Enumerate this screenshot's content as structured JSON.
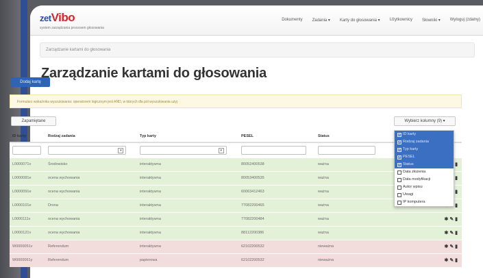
{
  "brand": {
    "zet": "zet",
    "logo": "Vibo",
    "subtitle": "system zarządzania procesem głosowania"
  },
  "nav": [
    "Dokumenty",
    "Zadania ▾",
    "Karty do głosowania ▾",
    "Użytkownicy",
    "Słowniki ▾",
    "Wyloguj (zdalny)"
  ],
  "breadcrumb": "Zarządzanie kartami do głosowania",
  "page_title": "Zarządzanie kartami do głosowania",
  "add_button": "Dodaj kartę",
  "alert": "Formularz wskaźnika wyszukiwania: operatorem logicznym jest AND, w których dla pól wyszukiwania użyj",
  "saved_button": "Zapamiętane",
  "columns_button": "Wybierz kolumny (9) ▾",
  "columns": [
    "ID karty",
    "Rodzaj zadania",
    "Typ karty",
    "PESEL",
    "Status",
    ""
  ],
  "rows": [
    {
      "id": "L0000071v",
      "task": "Środowisko",
      "type": "interaktywna",
      "pesel": "80052400538",
      "status": "ważna",
      "state": "ok"
    },
    {
      "id": "L0000081e",
      "task": "ocena wychowania",
      "type": "interaktywna",
      "pesel": "80053400535",
      "status": "ważna",
      "state": "ok"
    },
    {
      "id": "L0000091e",
      "task": "ocena wychowania",
      "type": "interaktywna",
      "pesel": "60063412463",
      "status": "ważna",
      "state": "ok"
    },
    {
      "id": "L0000101e",
      "task": "Drona",
      "type": "interaktywna",
      "pesel": "77082200465",
      "status": "ważna",
      "state": "ok"
    },
    {
      "id": "L0000111v",
      "task": "ocena wychowania",
      "type": "interaktywna",
      "pesel": "77082200484",
      "status": "ważna",
      "state": "ok"
    },
    {
      "id": "L0000121v",
      "task": "ocena wychowania",
      "type": "interaktywna",
      "pesel": "88112200386",
      "status": "ważna",
      "state": "ok"
    },
    {
      "id": "W0000051v",
      "task": "Referendum",
      "type": "interaktywna",
      "pesel": "62102200532",
      "status": "nieważna",
      "state": "bad"
    },
    {
      "id": "W0000061y",
      "task": "Referendum",
      "type": "papierowa",
      "pesel": "62102200532",
      "status": "nieważna",
      "state": "bad"
    }
  ],
  "column_menu": [
    {
      "label": "ID karty",
      "checked": true
    },
    {
      "label": "Rodzaj zadania",
      "checked": true
    },
    {
      "label": "Typ karty",
      "checked": true
    },
    {
      "label": "PESEL",
      "checked": true
    },
    {
      "label": "Status",
      "checked": true
    },
    {
      "label": "Data złożenia",
      "checked": false
    },
    {
      "label": "Data modyfikacji",
      "checked": false
    },
    {
      "label": "Autor wpisu",
      "checked": false
    },
    {
      "label": "Uwagi",
      "checked": false
    },
    {
      "label": "IP komputera",
      "checked": false
    }
  ],
  "actions_glyph": "✱ ✎ ▮",
  "colors": {
    "accent": "#2f63b5",
    "valid_row": "#e4f1d9",
    "invalid_row": "#f3dcdc",
    "frame": "#2e4f93"
  }
}
